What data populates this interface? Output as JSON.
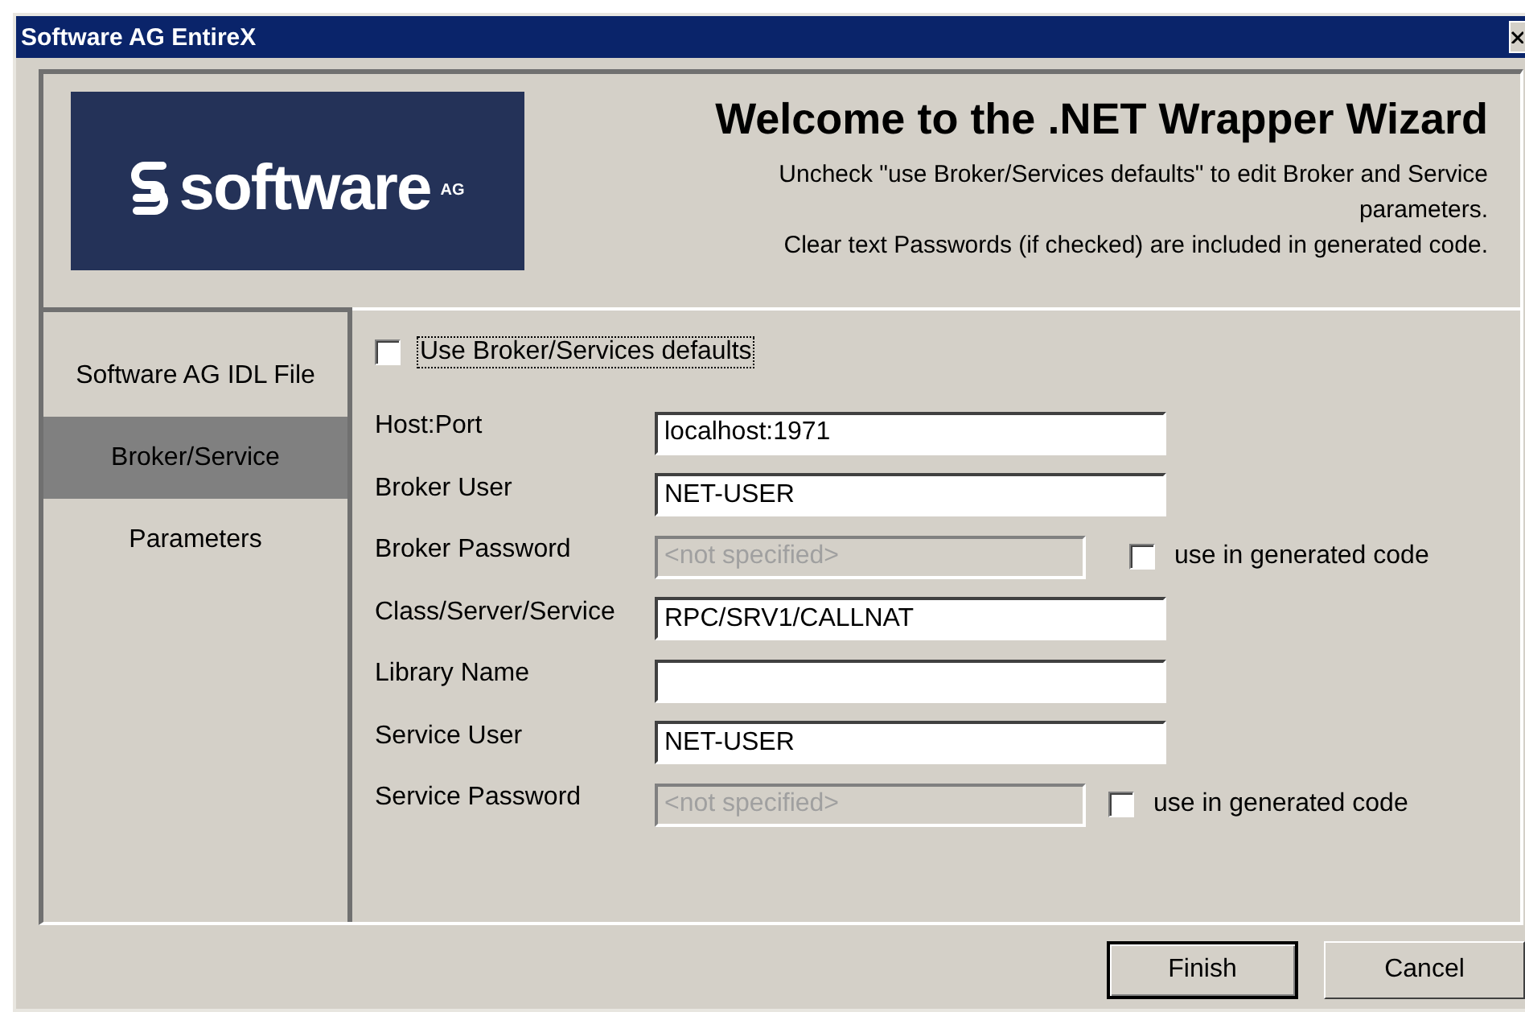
{
  "window": {
    "title": "Software AG EntireX"
  },
  "logo": {
    "name": "software",
    "suffix": "AG"
  },
  "header": {
    "title": "Welcome to the .NET Wrapper Wizard",
    "lines": [
      "Uncheck \"use Broker/Services defaults\" to edit Broker and Service parameters.",
      "Clear text Passwords (if checked) are included in generated code."
    ]
  },
  "nav": [
    {
      "label": "Software AG IDL File",
      "selected": false
    },
    {
      "label": "Broker/Service",
      "selected": true
    },
    {
      "label": "Parameters",
      "selected": false
    }
  ],
  "defaults": {
    "label": "Use Broker/Services defaults",
    "checked": false
  },
  "fields": [
    {
      "kind": "text",
      "label": "Host:Port",
      "value": "localhost:1971"
    },
    {
      "kind": "text",
      "label": "Broker User",
      "value": "NET-USER"
    },
    {
      "kind": "password",
      "label": "Broker Password",
      "placeholder": "<not specified>",
      "option": {
        "label": "use in generated code",
        "checked": false
      }
    },
    {
      "kind": "text",
      "label": "Class/Server/Service",
      "value": "RPC/SRV1/CALLNAT"
    },
    {
      "kind": "text",
      "label": "Library Name"
    },
    {
      "kind": "text",
      "label": "Service User",
      "value": "NET-USER"
    },
    {
      "kind": "password",
      "label": "Service Password",
      "placeholder": "<not specified>",
      "option": {
        "label": "use in generated code",
        "checked": false
      }
    }
  ],
  "buttons": [
    {
      "label": "Finish",
      "default": true
    },
    {
      "label": "Cancel",
      "default": false
    }
  ]
}
